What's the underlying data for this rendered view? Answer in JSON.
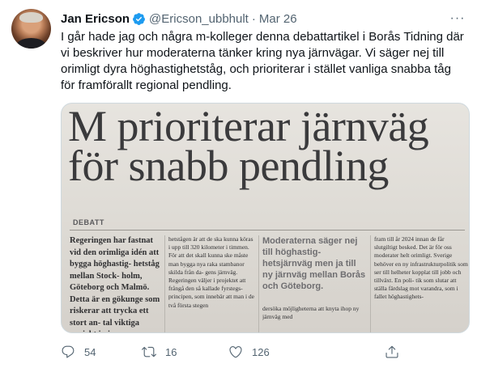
{
  "tweet": {
    "author_name": "Jan Ericson",
    "handle": "@Ericson_ubbhult",
    "separator": "·",
    "date": "Mar 26",
    "more_label": "···",
    "text": "I går hade jag och några m-kolleger denna debattartikel i Borås Tidning där vi beskriver hur moderaterna tänker kring nya järnvägar. Vi säger nej till orimligt dyra höghastighetståg, och prioriterar i stället vanliga snabba tåg för framförallt regional pendling."
  },
  "newspaper": {
    "headline_line1": "M prioriterar järnväg",
    "headline_line2": "för snabb pendling",
    "section": "DEBATT",
    "col1": "Regeringen har fastnat vid den orimliga idén att bygga höghastig- hetståg mellan Stock- holm, Göteborg och Malmö. Detta är en gökunge som riskerar att trycka ett stort an- tal viktiga projekt in i",
    "col2": "hetstågen är att de ska kunna köras i upp till 320 kilometer i timmen. För att det skall kunna ske måste man bygga nya raka stambanor skilda från da- gens järnväg. Regeringen väljer i projektet att frångå den så kallade fyrstegs- principen, som innebär att man i de två första stegen",
    "pullquote": "Moderaterna säger nej till höghastig- hetsjärnväg men ja till ny järnväg mellan Borås och Göteborg.",
    "col3": "dersöka möjligheterna att knyta ihop ny järnväg med",
    "col4": "fram till år 2024 innan de får slutgiltigt besked. Det är för oss moderater helt orimligt. Sverige behöver en ny infrastrukturpolitik som ser till helheter kopplat till jobb och tillväxt. En poli- tik som slutar att ställa färdslag mot varandra, som i fallet höghastighets-"
  },
  "actions": {
    "reply_count": "54",
    "retweet_count": "16",
    "like_count": "126"
  },
  "colors": {
    "verified": "#1d9bf0",
    "secondary_text": "#536471",
    "primary_text": "#0f1419"
  }
}
